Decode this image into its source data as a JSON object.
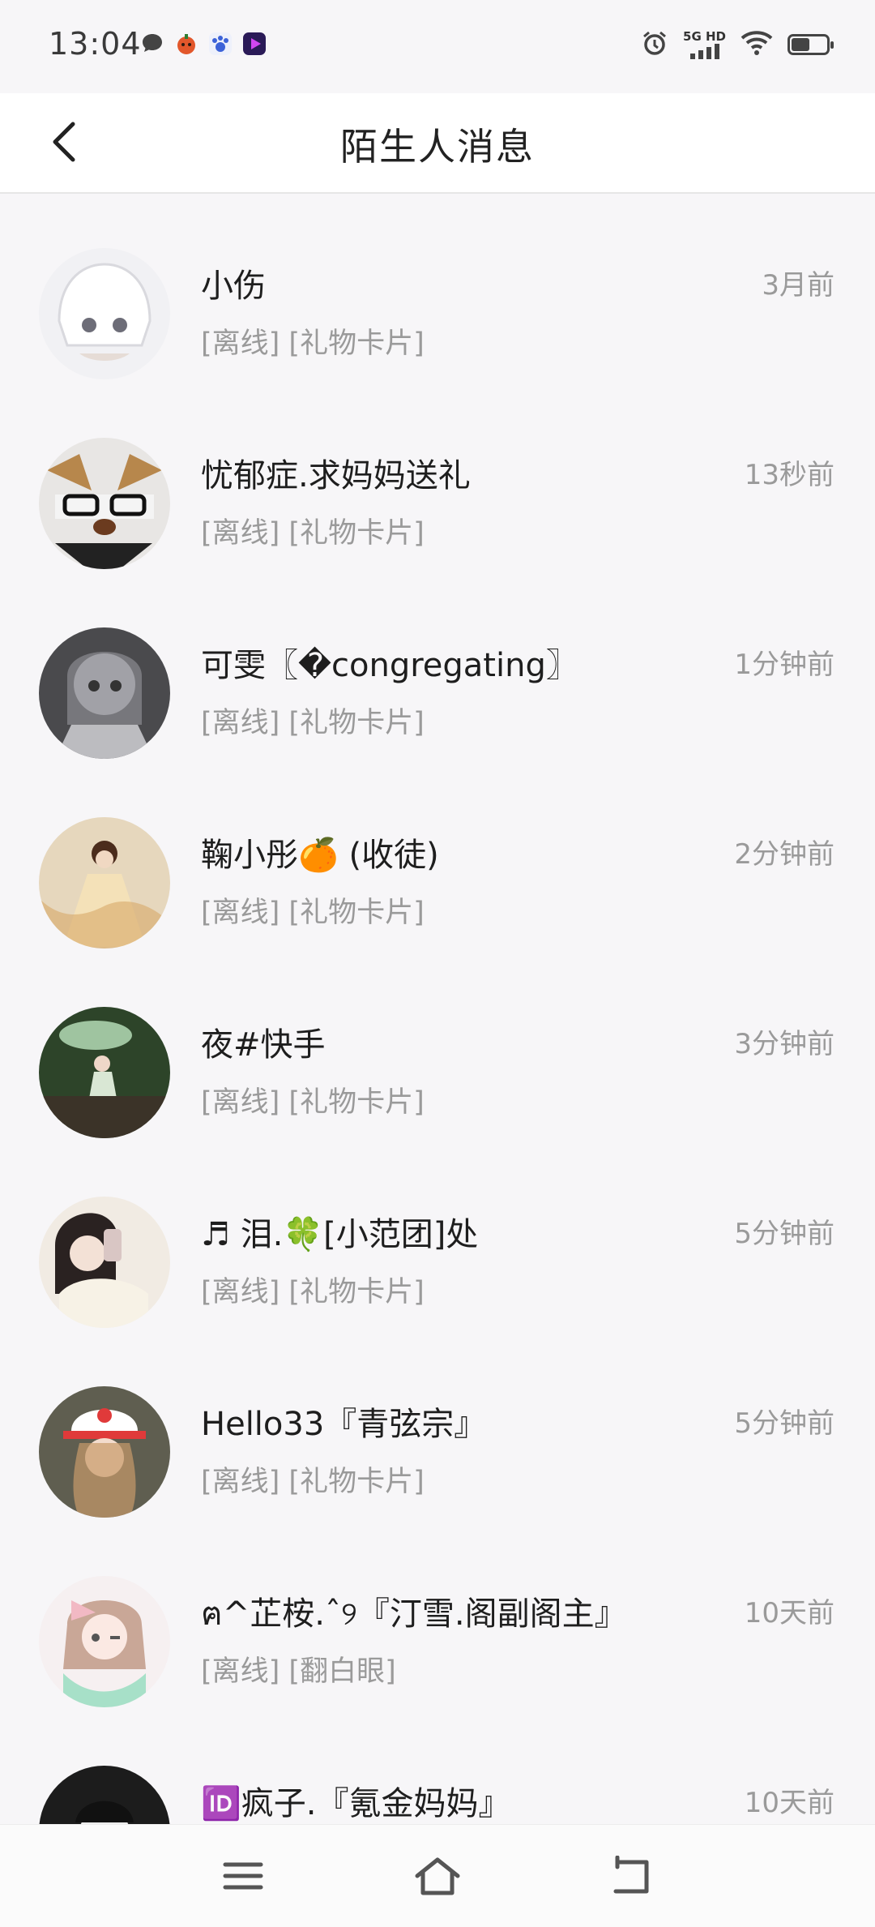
{
  "status_bar": {
    "time": "13:04",
    "network_label": "5G HD",
    "icons_left": [
      "message-icon",
      "pumpkin-app-icon",
      "paw-app-icon",
      "video-app-icon"
    ],
    "icons_right": [
      "alarm-icon",
      "signal-icon",
      "wifi-icon",
      "battery-icon"
    ]
  },
  "header": {
    "title": "陌生人消息",
    "back_icon": "chevron-left-icon"
  },
  "conversations": [
    {
      "name": "小伤",
      "preview": "[离线] [礼物卡片]",
      "time": "3月前",
      "avatar_color": "#e9e9ee"
    },
    {
      "name": "忧郁症.求妈妈送礼",
      "preview": "[离线] [礼物卡片]",
      "time": "13秒前",
      "avatar_color": "#b9b1a8"
    },
    {
      "name": "可雯〖�congregating〗",
      "preview": "[离线] [礼物卡片]",
      "time": "1分钟前",
      "avatar_color": "#5e5e62"
    },
    {
      "name": "鞠小彤🍊 (收徒)",
      "preview": "[离线] [礼物卡片]",
      "time": "2分钟前",
      "avatar_color": "#d8c3a4"
    },
    {
      "name": "夜#快手",
      "preview": "[离线] [礼物卡片]",
      "time": "3分钟前",
      "avatar_color": "#3f5a3c"
    },
    {
      "name": "♬ 泪.🍀[小范团]处",
      "preview": "[离线] [礼物卡片]",
      "time": "5分钟前",
      "avatar_color": "#e7ddd0"
    },
    {
      "name": "Hello33『青弦宗』",
      "preview": "[离线] [礼物卡片]",
      "time": "5分钟前",
      "avatar_color": "#6b6a5a"
    },
    {
      "name": "ฅ^芷桉.ˆ୨『汀雪.阁副阁主』",
      "preview": "[离线] [翻白眼]",
      "time": "10天前",
      "avatar_color": "#efe3e5"
    },
    {
      "name": "🆔疯子.『氪金妈妈』",
      "preview": "",
      "time": "10天前",
      "avatar_color": "#2c2c2c"
    }
  ],
  "nav_bar": {
    "buttons": [
      "menu-icon",
      "home-icon",
      "back-icon"
    ]
  }
}
